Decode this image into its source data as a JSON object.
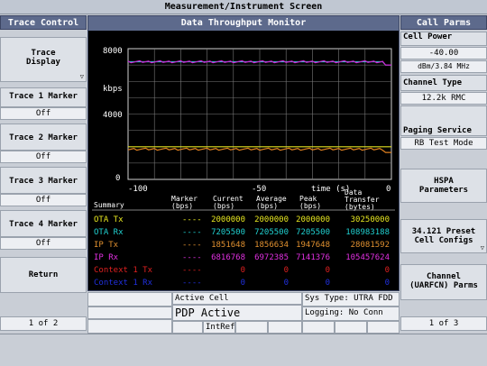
{
  "window_title": "Measurement/Instrument Screen",
  "left": {
    "header": "Trace Control",
    "keys": [
      {
        "label": "Trace\nDisplay",
        "value": null
      },
      {
        "label": "Trace 1 Marker",
        "value": "Off"
      },
      {
        "label": "Trace 2 Marker",
        "value": "Off"
      },
      {
        "label": "Trace 3 Marker",
        "value": "Off"
      },
      {
        "label": "Trace 4 Marker",
        "value": "Off"
      },
      {
        "label": "Return",
        "value": null
      }
    ],
    "page": "1 of 2"
  },
  "right": {
    "header": "Call Parms",
    "cell_power_label": "Cell Power",
    "cell_power_value": "-40.00",
    "cell_power_unit": "dBm/3.84 MHz",
    "channel_type_label": "Channel Type",
    "channel_type_value": "12.2k RMC",
    "paging_label": "Paging Service",
    "paging_value": "RB Test Mode",
    "hspa_label": "HSPA\nParameters",
    "preset_label": "34.121 Preset\nCell Configs",
    "channel_label": "Channel\n(UARFCN) Parms",
    "page": "1 of 3"
  },
  "monitor": {
    "title": "Data Throughput Monitor",
    "y_top": "8000",
    "y_unit": "kbps",
    "y_mid": "4000",
    "y_zero": "0",
    "x_labels": [
      "-100",
      "-50",
      "0"
    ],
    "x_axis_label": "time (s)"
  },
  "chart_data": {
    "type": "line",
    "title": "Data Throughput Monitor",
    "xlabel": "time (s)",
    "ylabel": "kbps",
    "xlim": [
      -100,
      0
    ],
    "ylim": [
      0,
      8000
    ],
    "series": [
      {
        "name": "OTA Tx",
        "color": "#e0e020",
        "values": [
          2000,
          2000
        ]
      },
      {
        "name": "OTA Rx",
        "color": "#20d0d0",
        "values": [
          7200,
          7200
        ]
      },
      {
        "name": "IP Tx",
        "color": "#e08020",
        "values": [
          1850,
          1850
        ]
      },
      {
        "name": "IP Rx",
        "color": "#d020d0",
        "values": [
          7200,
          7200
        ]
      }
    ]
  },
  "table": {
    "headers": [
      "Summary",
      "Marker\n(bps)",
      "Current\n(bps)",
      "Average\n(bps)",
      "Peak\n(bps)",
      "Data\nTransfer\n(bytes)"
    ],
    "rows": [
      {
        "name": "OTA Tx",
        "color": "#e8e820",
        "marker": "----",
        "current": "2000000",
        "average": "2000000",
        "peak": "2000000",
        "transfer": "30250000"
      },
      {
        "name": "OTA Rx",
        "color": "#20d0d0",
        "marker": "----",
        "current": "7205500",
        "average": "7205500",
        "peak": "7205500",
        "transfer": "108983188"
      },
      {
        "name": "IP Tx",
        "color": "#e09030",
        "marker": "----",
        "current": "1851648",
        "average": "1856634",
        "peak": "1947648",
        "transfer": "28081592"
      },
      {
        "name": "IP Rx",
        "color": "#e030e0",
        "marker": "----",
        "current": "6816768",
        "average": "6972385",
        "peak": "7141376",
        "transfer": "105457624"
      },
      {
        "name": "Context 1 Tx",
        "color": "#e02020",
        "marker": "----",
        "current": "0",
        "average": "0",
        "peak": "0",
        "transfer": "0"
      },
      {
        "name": "Context 1 Rx",
        "color": "#2030e0",
        "marker": "----",
        "current": "0",
        "average": "0",
        "peak": "0",
        "transfer": "0"
      }
    ]
  },
  "status": {
    "active_cell_label": "Active Cell",
    "active_cell_value": "PDP Active",
    "sys_type": "Sys Type: UTRA FDD",
    "logging": "Logging: No Conn",
    "intref": "IntRef"
  }
}
